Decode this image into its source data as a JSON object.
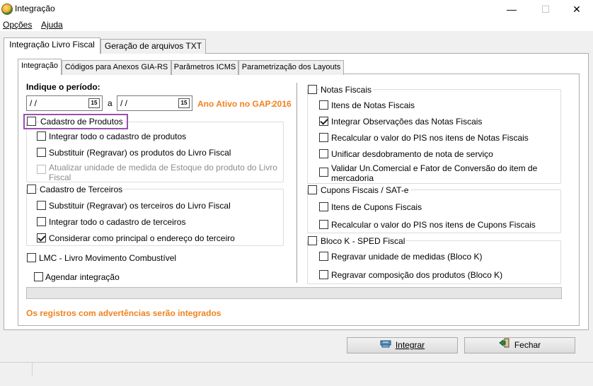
{
  "window": {
    "title": "Integração",
    "minimize_glyph": "—",
    "maximize_glyph": "☐",
    "close_glyph": "✕"
  },
  "menu": {
    "opcoes": "Opções",
    "ajuda": "Ajuda"
  },
  "outer_tabs": [
    "Integração Livro Fiscal",
    "Geração de arquivos TXT"
  ],
  "inner_tabs": [
    "Integração",
    "Códigos para Anexos GIA-RS",
    "Parâmetros ICMS",
    "Parametrização dos Layouts"
  ],
  "period": {
    "label": "Indique o período:",
    "start_value": " / /",
    "end_value": " / /",
    "separator": "a",
    "calendar_glyph": "15",
    "year_label": "Ano Ativo no GAP:",
    "year_value": "2016"
  },
  "left": {
    "cadastro_produtos": {
      "label": "Cadastro de Produtos",
      "checked": false,
      "options": [
        {
          "label": "Integrar todo o cadastro de produtos",
          "checked": false,
          "disabled": false
        },
        {
          "label": "Substituir (Regravar) os produtos do Livro Fiscal",
          "checked": false,
          "disabled": false
        },
        {
          "label": "Atualizar unidade de medida de Estoque do produto do Livro",
          "label2": "Fiscal",
          "checked": false,
          "disabled": true
        }
      ]
    },
    "cadastro_terceiros": {
      "label": "Cadastro de Terceiros",
      "checked": false,
      "options": [
        {
          "label": "Substituir (Regravar) os terceiros do Livro Fiscal",
          "checked": false
        },
        {
          "label": "Integrar todo o cadastro de terceiros",
          "checked": false
        },
        {
          "label": "Considerar como principal o endereço do terceiro",
          "checked": true
        }
      ]
    },
    "lmc": {
      "label": "LMC - Livro Movimento Combustível",
      "checked": false
    },
    "agendar": {
      "label": "Agendar integração",
      "checked": false
    }
  },
  "right": {
    "notas_fiscais": {
      "label": "Notas Fiscais",
      "checked": false,
      "options": [
        {
          "label": "Itens de Notas Fiscais",
          "checked": false
        },
        {
          "label": "Integrar Observações das Notas Fiscais",
          "checked": true
        },
        {
          "label": "Recalcular o valor do PIS nos itens de Notas Fiscais",
          "checked": false
        },
        {
          "label": "Unificar desdobramento de nota de serviço",
          "checked": false
        },
        {
          "label": "Validar Un.Comercial e Fator de Conversão do item de",
          "label2": "mercadoria",
          "checked": false
        }
      ]
    },
    "cupons_fiscais": {
      "label": "Cupons Fiscais / SAT-e",
      "checked": false,
      "options": [
        {
          "label": "Itens de Cupons Fiscais",
          "checked": false
        },
        {
          "label": "Recalcular o valor do PIS nos itens de Cupons Fiscais",
          "checked": false
        }
      ]
    },
    "bloco_k": {
      "label": "Bloco K - SPED Fiscal",
      "checked": false,
      "options": [
        {
          "label": "Regravar unidade de medidas (Bloco K)",
          "checked": false
        },
        {
          "label": "Regravar composição dos produtos (Bloco K)",
          "checked": false
        }
      ]
    }
  },
  "progress": {
    "value": 0
  },
  "warning": "Os registros com advertências serão integrados",
  "buttons": {
    "integrar": "Integrar",
    "fechar": "Fechar"
  },
  "colors": {
    "accent_orange": "#f0821e",
    "highlight_purple": "#9b4fb0"
  }
}
